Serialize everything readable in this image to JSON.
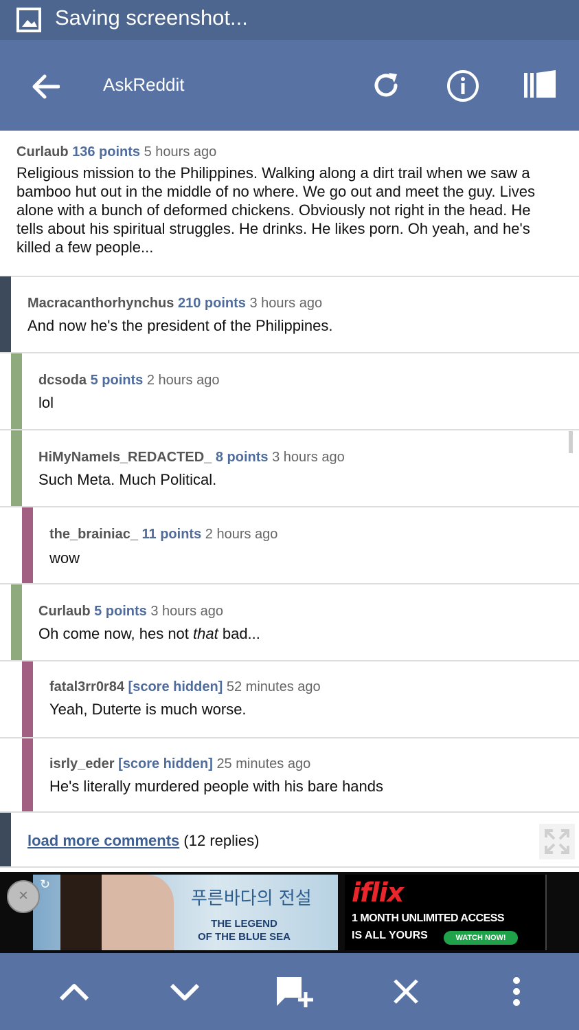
{
  "status_bar": {
    "text": "Saving screenshot..."
  },
  "toolbar": {
    "title": "AskReddit"
  },
  "comments": [
    {
      "author": "Curlaub",
      "points": "136 points",
      "age": "5 hours ago",
      "body": "Religious mission to the Philippines. Walking along a dirt trail when we saw a bamboo hut out in the middle of no where. We go out and meet the guy. Lives alone with a bunch of deformed chickens. Obviously not right in the head. He tells about his spiritual struggles. He drinks. He likes porn. Oh yeah, and he's killed a few people..."
    },
    {
      "author": "Macracanthorhynchus",
      "points": "210 points",
      "age": "3 hours ago",
      "body": "And now he's the president of the Philippines.",
      "bar_color": "#3d4a5c"
    },
    {
      "author": "dcsoda",
      "points": "5 points",
      "age": "2 hours ago",
      "body": "lol",
      "bar_color": "#8faa7c"
    },
    {
      "author": "HiMyNameIs_REDACTED_",
      "points": "8 points",
      "age": "3 hours ago",
      "body": "Such Meta. Much Political.",
      "bar_color": "#8faa7c"
    },
    {
      "author": "the_brainiac_",
      "points": "11 points",
      "age": "2 hours ago",
      "body": "wow",
      "bar_color": "#a35f82"
    },
    {
      "author": "Curlaub",
      "points": "5 points",
      "age": "3 hours ago",
      "body_before": "Oh come now, hes not ",
      "body_em": "that",
      "body_after": " bad...",
      "bar_color": "#8faa7c"
    },
    {
      "author": "fatal3rr0r84",
      "points": "[score hidden]",
      "age": "52 minutes ago",
      "body": "Yeah, Duterte is much worse.",
      "bar_color": "#a35f82"
    },
    {
      "author": "isrly_eder",
      "points": "[score hidden]",
      "age": "25 minutes ago",
      "body": "He's literally murdered people with his bare hands",
      "bar_color": "#a35f82"
    }
  ],
  "load_more": {
    "link": "load more comments",
    "count": "(12 replies)"
  },
  "ad": {
    "script_title": "푸른바다의 전설",
    "title_line1": "THE LEGEND",
    "title_line2": "OF THE BLUE SEA",
    "brand": "iflix",
    "line1": "1 MONTH UNLIMITED ACCESS",
    "line2": "IS ALL YOURS",
    "cta": "WATCH NOW!"
  },
  "colors": {
    "status_bar": "#4d6690",
    "toolbar": "#5873a3",
    "points": "#4f6c9c"
  }
}
